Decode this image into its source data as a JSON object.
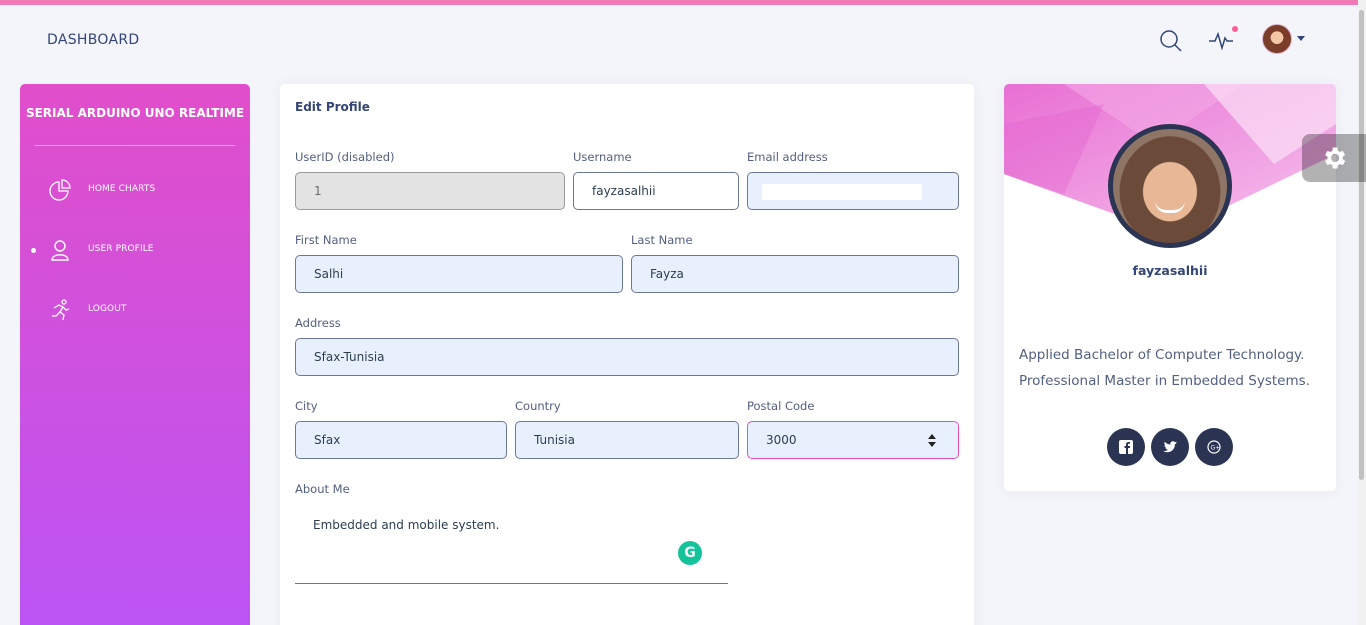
{
  "navbar": {
    "brand": "DASHBOARD"
  },
  "sidebar": {
    "title": "SERIAL ARDUINO UNO REALTIME",
    "items": [
      {
        "label": "HOME CHARTS",
        "icon": "pie-chart-icon",
        "active": false
      },
      {
        "label": "USER PROFILE",
        "icon": "user-icon",
        "active": true
      },
      {
        "label": "LOGOUT",
        "icon": "running-person-icon",
        "active": false
      }
    ]
  },
  "form": {
    "title": "Edit Profile",
    "userid": {
      "label": "UserID (disabled)",
      "value": "1"
    },
    "username": {
      "label": "Username",
      "value": "fayzasalhii"
    },
    "email": {
      "label": "Email address",
      "value": ""
    },
    "first_name": {
      "label": "First Name",
      "value": "Salhi"
    },
    "last_name": {
      "label": "Last Name",
      "value": "Fayza"
    },
    "address": {
      "label": "Address",
      "value": "Sfax-Tunisia"
    },
    "city": {
      "label": "City",
      "value": "Sfax"
    },
    "country": {
      "label": "Country",
      "value": "Tunisia"
    },
    "postal": {
      "label": "Postal Code",
      "value": "3000"
    },
    "about": {
      "label": "About Me",
      "value": "Embedded and mobile system."
    }
  },
  "profile": {
    "name": "fayzasalhii",
    "description_line1": "Applied Bachelor of Computer Technology.",
    "description_line2": "Professional Master in Embedded Systems."
  },
  "colors": {
    "accent_pink": "#e14eca",
    "accent_purple": "#ba54f5",
    "dark_navy": "#2b3553"
  }
}
